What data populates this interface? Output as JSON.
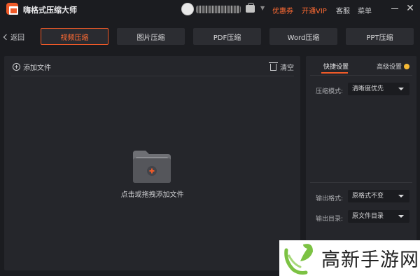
{
  "app": {
    "title": "嗨格式压缩大师"
  },
  "titlebar": {
    "coupon_label": "优惠券",
    "vip_label": "开通VIP",
    "service_label": "客服",
    "menu_label": "菜单",
    "minimize_icon": "minimize-icon",
    "close_icon": "close-icon",
    "close_glyph": "✕"
  },
  "nav": {
    "back_label": "返回",
    "tabs": [
      {
        "label": "视频压缩",
        "active": true
      },
      {
        "label": "图片压缩",
        "active": false
      },
      {
        "label": "PDF压缩",
        "active": false
      },
      {
        "label": "Word压缩",
        "active": false
      },
      {
        "label": "PPT压缩",
        "active": false
      }
    ]
  },
  "file_panel": {
    "add_file_label": "添加文件",
    "clear_label": "清空",
    "drop_hint": "点击或拖拽添加文件"
  },
  "settings": {
    "tabs": {
      "quick": "快捷设置",
      "advanced": "高级设置"
    },
    "compress_mode_label": "压缩模式:",
    "compress_mode_value": "清晰度优先",
    "output_format_label": "输出格式:",
    "output_format_value": "原格式不变",
    "output_dir_label": "输出目录:",
    "output_dir_value": "原文件目录"
  },
  "watermark": {
    "text": "高新手游网"
  },
  "colors": {
    "accent": "#f05a28",
    "bg": "#1b1c20",
    "panel": "#25262b",
    "tab": "#2c2d32"
  }
}
